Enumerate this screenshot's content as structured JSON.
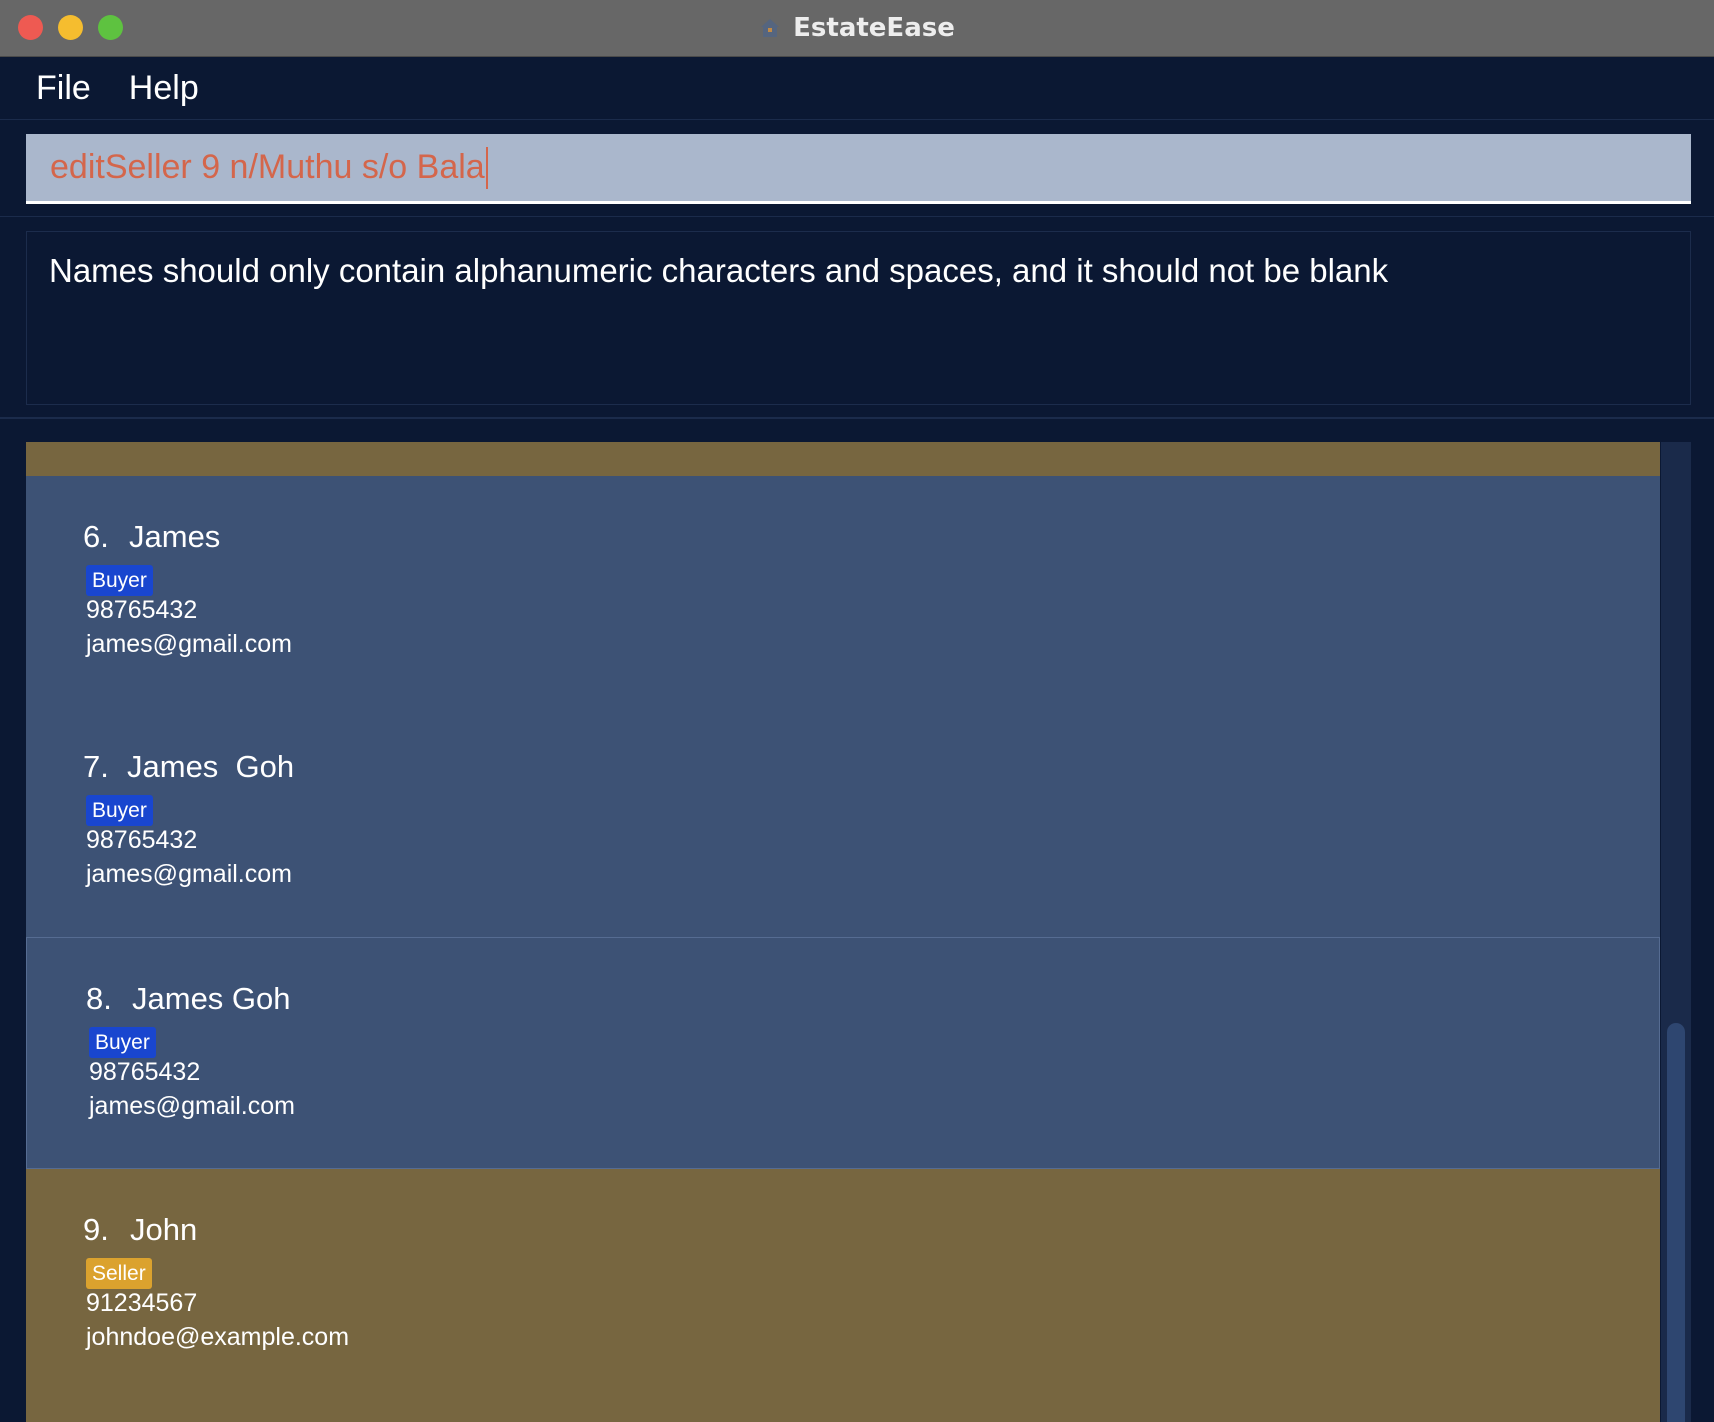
{
  "window": {
    "title": "EstateEase"
  },
  "menu": {
    "items": [
      {
        "label": "File"
      },
      {
        "label": "Help"
      }
    ]
  },
  "command": {
    "value": "editSeller 9 n/Muthu s/o Bala"
  },
  "result": {
    "message": "Names should only contain alphanumeric characters and spaces, and it should not be blank"
  },
  "persons": [
    {
      "index": "6.",
      "name": "James",
      "tag": "Buyer",
      "phone": "98765432",
      "email": "james@gmail.com"
    },
    {
      "index": "7.",
      "name": "James  Goh",
      "tag": "Buyer",
      "phone": "98765432",
      "email": "james@gmail.com"
    },
    {
      "index": "8.",
      "name": "James Goh",
      "tag": "Buyer",
      "phone": "98765432",
      "email": "james@gmail.com"
    },
    {
      "index": "9.",
      "name": "John",
      "tag": "Seller",
      "phone": "91234567",
      "email": "johndoe@example.com"
    }
  ],
  "colors": {
    "background": "#0b1833",
    "buyer_card": "#3d5275",
    "seller_card": "#776640",
    "buyer_tag": "#1946cf",
    "seller_tag": "#dba22e",
    "command_text": "#d4664b"
  }
}
